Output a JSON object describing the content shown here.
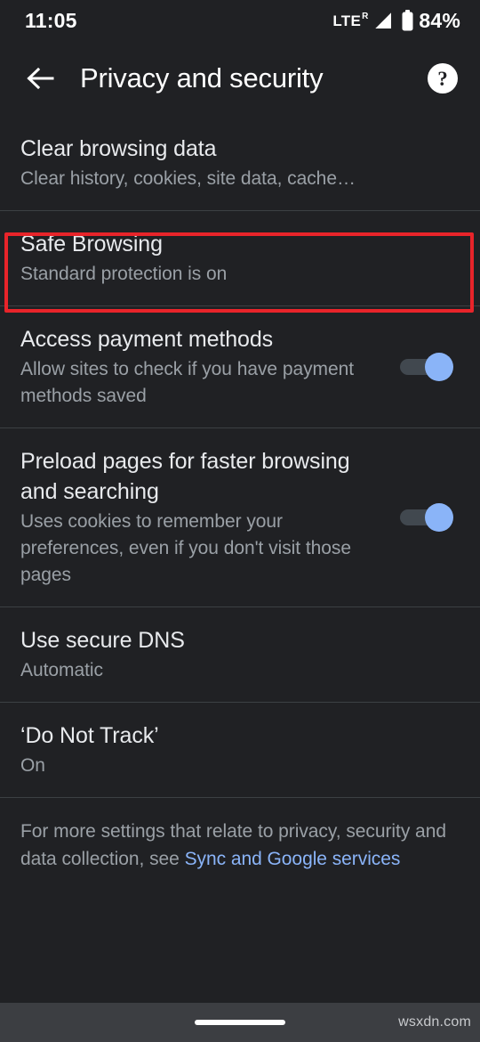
{
  "status_bar": {
    "time": "11:05",
    "network_label": "LTE",
    "network_sup": "R",
    "battery_percent": "84%",
    "icons": [
      "signal-icon",
      "battery-icon"
    ]
  },
  "app_bar": {
    "back_icon": "back-arrow-icon",
    "title": "Privacy and security",
    "help_icon": "help-icon",
    "help_glyph": "?"
  },
  "settings": [
    {
      "name": "clear-browsing-data",
      "title": "Clear browsing data",
      "subtitle": "Clear history, cookies, site data, cache…",
      "has_toggle": false,
      "highlighted": true
    },
    {
      "name": "safe-browsing",
      "title": "Safe Browsing",
      "subtitle": "Standard protection is on",
      "has_toggle": false,
      "highlighted": false
    },
    {
      "name": "access-payment-methods",
      "title": "Access payment methods",
      "subtitle": "Allow sites to check if you have payment methods saved",
      "has_toggle": true,
      "toggle_state": "on",
      "highlighted": false
    },
    {
      "name": "preload-pages",
      "title": "Preload pages for faster browsing and searching",
      "subtitle": "Uses cookies to remember your preferences, even if you don't visit those pages",
      "has_toggle": true,
      "toggle_state": "on",
      "highlighted": false
    },
    {
      "name": "use-secure-dns",
      "title": "Use secure DNS",
      "subtitle": "Automatic",
      "has_toggle": false,
      "highlighted": false
    },
    {
      "name": "do-not-track",
      "title": "‘Do Not Track’",
      "subtitle": "On",
      "has_toggle": false,
      "highlighted": false
    }
  ],
  "footer": {
    "text_before": "For more settings that relate to privacy, security and data collection, see ",
    "link_text": "Sync and Google services"
  },
  "nav_bar": {
    "watermark": "wsxdn.com"
  },
  "colors": {
    "background": "#202124",
    "divider": "#3c4043",
    "title_text": "#e8eaed",
    "secondary_text": "#9aa0a6",
    "accent_blue": "#8ab4f8",
    "toggle_track": "#41484f",
    "highlight_red": "#e8242a",
    "nav_bar": "#3c3e42"
  }
}
